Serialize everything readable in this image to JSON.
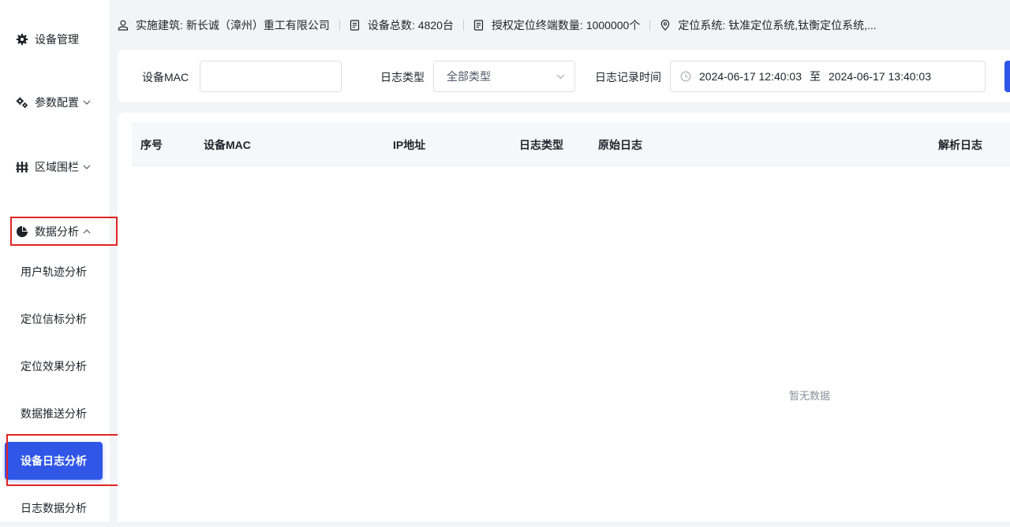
{
  "sidebar": {
    "items": [
      {
        "label": "设备管理",
        "icon": "gear-icon"
      },
      {
        "label": "参数配置",
        "icon": "gears-icon"
      },
      {
        "label": "区域围栏",
        "icon": "fence-icon"
      },
      {
        "label": "数据分析",
        "icon": "pie-chart-icon"
      }
    ],
    "sub_items": [
      "用户轨迹分析",
      "定位信标分析",
      "定位效果分析",
      "数据推送分析",
      "设备日志分析",
      "日志数据分析"
    ],
    "active_sub": "设备日志分析"
  },
  "infobar": {
    "building_label": "实施建筑:",
    "building_value": "新长诚（漳州）重工有限公司",
    "device_total_label": "设备总数:",
    "device_total_value": "4820台",
    "authorized_label": "授权定位终端数量:",
    "authorized_value": "1000000个",
    "positioning_label": "定位系统:",
    "positioning_value": "钛准定位系统,钛衡定位系统,..."
  },
  "filters": {
    "mac_label": "设备MAC",
    "mac_value": "",
    "log_type_label": "日志类型",
    "log_type_value": "全部类型",
    "time_label": "日志记录时间",
    "time_start": "2024-06-17 12:40:03",
    "time_sep": "至",
    "time_end": "2024-06-17 13:40:03"
  },
  "table": {
    "columns": [
      "序号",
      "设备MAC",
      "IP地址",
      "日志类型",
      "原始日志",
      "解析日志"
    ],
    "rows": [],
    "empty_text": "暂无数据"
  },
  "colors": {
    "primary": "#3056e8",
    "highlight_box": "#e02424",
    "background": "#f3f4f6"
  }
}
